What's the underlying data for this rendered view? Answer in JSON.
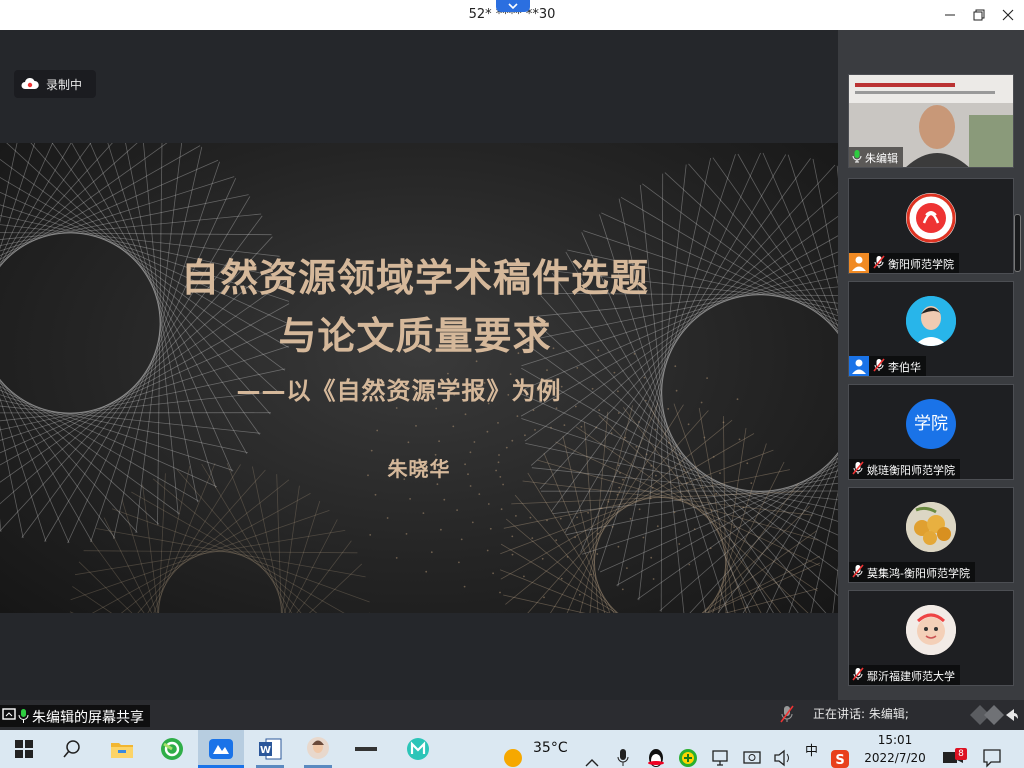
{
  "window": {
    "title": "52* **** **30"
  },
  "recording": {
    "label": "录制中"
  },
  "slide": {
    "title_line1": "自然资源领域学术稿件选题",
    "title_line2": "与论文质量要求",
    "subtitle": "——以《自然资源学报》为例",
    "author": "朱晓华"
  },
  "participants": [
    {
      "name": "朱编辑",
      "mic": "on"
    },
    {
      "name": "衡阳师范学院",
      "mic": "off"
    },
    {
      "name": "李伯华",
      "mic": "off"
    },
    {
      "name": "姚琏衡阳师范学院",
      "mic": "off",
      "avatar_text": "学院"
    },
    {
      "name": "莫集鸿-衡阳师范学院",
      "mic": "off"
    },
    {
      "name": "鄢沂福建师范大学",
      "mic": "off"
    }
  ],
  "meetbar": {
    "share_label": "朱编辑的屏幕共享",
    "speaking_label": "正在讲话: 朱编辑;"
  },
  "taskbar": {
    "weather": "35°C",
    "ime": "中",
    "time": "15:01",
    "date": "2022/7/20",
    "notification_count": "8"
  },
  "colors": {
    "accent_blue": "#1a73e8",
    "slide_gold": "#d5b89a",
    "panel_bg": "#3a3c40",
    "taskbar_bg": "#dbe8f2"
  }
}
